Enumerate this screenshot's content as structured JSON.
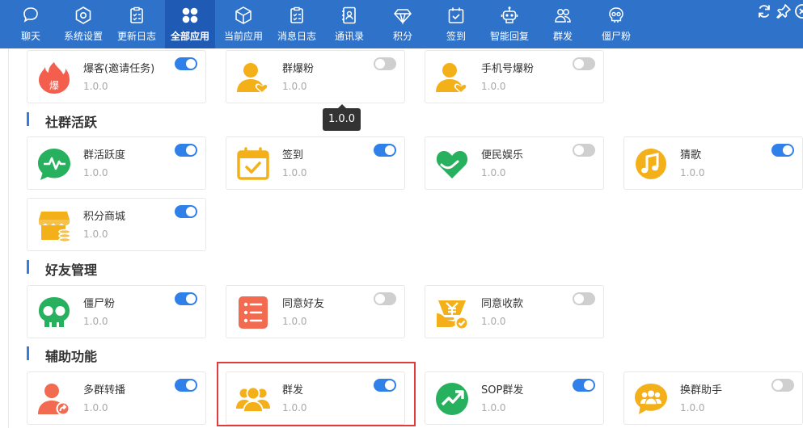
{
  "nav": {
    "tabs": [
      {
        "label": "聊天",
        "icon": "chat-bubble-icon"
      },
      {
        "label": "系统设置",
        "icon": "gear-icon"
      },
      {
        "label": "更新日志",
        "icon": "clipboard-icon"
      },
      {
        "label": "全部应用",
        "icon": "grid-icon",
        "active": true
      },
      {
        "label": "当前应用",
        "icon": "cube-icon"
      },
      {
        "label": "消息日志",
        "icon": "clipboard-icon"
      },
      {
        "label": "通讯录",
        "icon": "contacts-book-icon"
      },
      {
        "label": "积分",
        "icon": "diamond-icon"
      },
      {
        "label": "签到",
        "icon": "calendar-check-icon"
      },
      {
        "label": "智能回复",
        "icon": "robot-icon"
      },
      {
        "label": "群发",
        "icon": "group-icon"
      },
      {
        "label": "僵尸粉",
        "icon": "skull-icon"
      }
    ]
  },
  "window_controls": [
    "refresh-icon",
    "pin-icon",
    "close-circle-icon"
  ],
  "sections": {
    "s1": {
      "title": "社群活跃"
    },
    "s2": {
      "title": "好友管理"
    },
    "s3": {
      "title": "辅助功能"
    }
  },
  "apps": {
    "baofen": {
      "name": "爆客(邀请任务)",
      "version": "1.0.0",
      "enabled": true,
      "icon": "flame-icon"
    },
    "qunbaofen": {
      "name": "群爆粉",
      "version": "1.0.0",
      "enabled": false,
      "icon": "user-heart-icon"
    },
    "phonebaofen": {
      "name": "手机号爆粉",
      "version": "1.0.0",
      "enabled": false,
      "icon": "user-heart-icon"
    },
    "qunhuoyue": {
      "name": "群活跃度",
      "version": "1.0.0",
      "enabled": true,
      "icon": "pulse-chat-icon"
    },
    "qiandao": {
      "name": "签到",
      "version": "1.0.0",
      "enabled": true,
      "icon": "calendar-check-icon"
    },
    "bianmin": {
      "name": "便民娱乐",
      "version": "1.0.0",
      "enabled": false,
      "icon": "heart-icon"
    },
    "caige": {
      "name": "猜歌",
      "version": "1.0.0",
      "enabled": true,
      "icon": "music-note-icon"
    },
    "jifen": {
      "name": "积分商城",
      "version": "1.0.0",
      "enabled": true,
      "icon": "store-coins-icon"
    },
    "jiangshi": {
      "name": "僵尸粉",
      "version": "1.0.0",
      "enabled": true,
      "icon": "skull-icon"
    },
    "tongyihaoyou": {
      "name": "同意好友",
      "version": "1.0.0",
      "enabled": false,
      "icon": "list-icon"
    },
    "tongyishoukuan": {
      "name": "同意收款",
      "version": "1.0.0",
      "enabled": false,
      "icon": "yuan-check-icon"
    },
    "duoqun": {
      "name": "多群转播",
      "version": "1.0.0",
      "enabled": true,
      "icon": "user-share-icon"
    },
    "qunfa": {
      "name": "群发",
      "version": "1.0.0",
      "enabled": true,
      "icon": "group-icon"
    },
    "sop": {
      "name": "SOP群发",
      "version": "1.0.0",
      "enabled": true,
      "icon": "trend-up-icon"
    },
    "huanqun": {
      "name": "换群助手",
      "version": "1.0.0",
      "enabled": false,
      "icon": "group-chat-icon"
    }
  },
  "tooltip": {
    "text": "1.0.0"
  },
  "colors": {
    "topbar": "#2f72c9",
    "active_tab": "#1f5bb5",
    "toggle_on": "#2f80e8",
    "toggle_off": "#cfcfcf",
    "section_bar": "#2f7fe3",
    "highlight": "#e23b3b"
  }
}
